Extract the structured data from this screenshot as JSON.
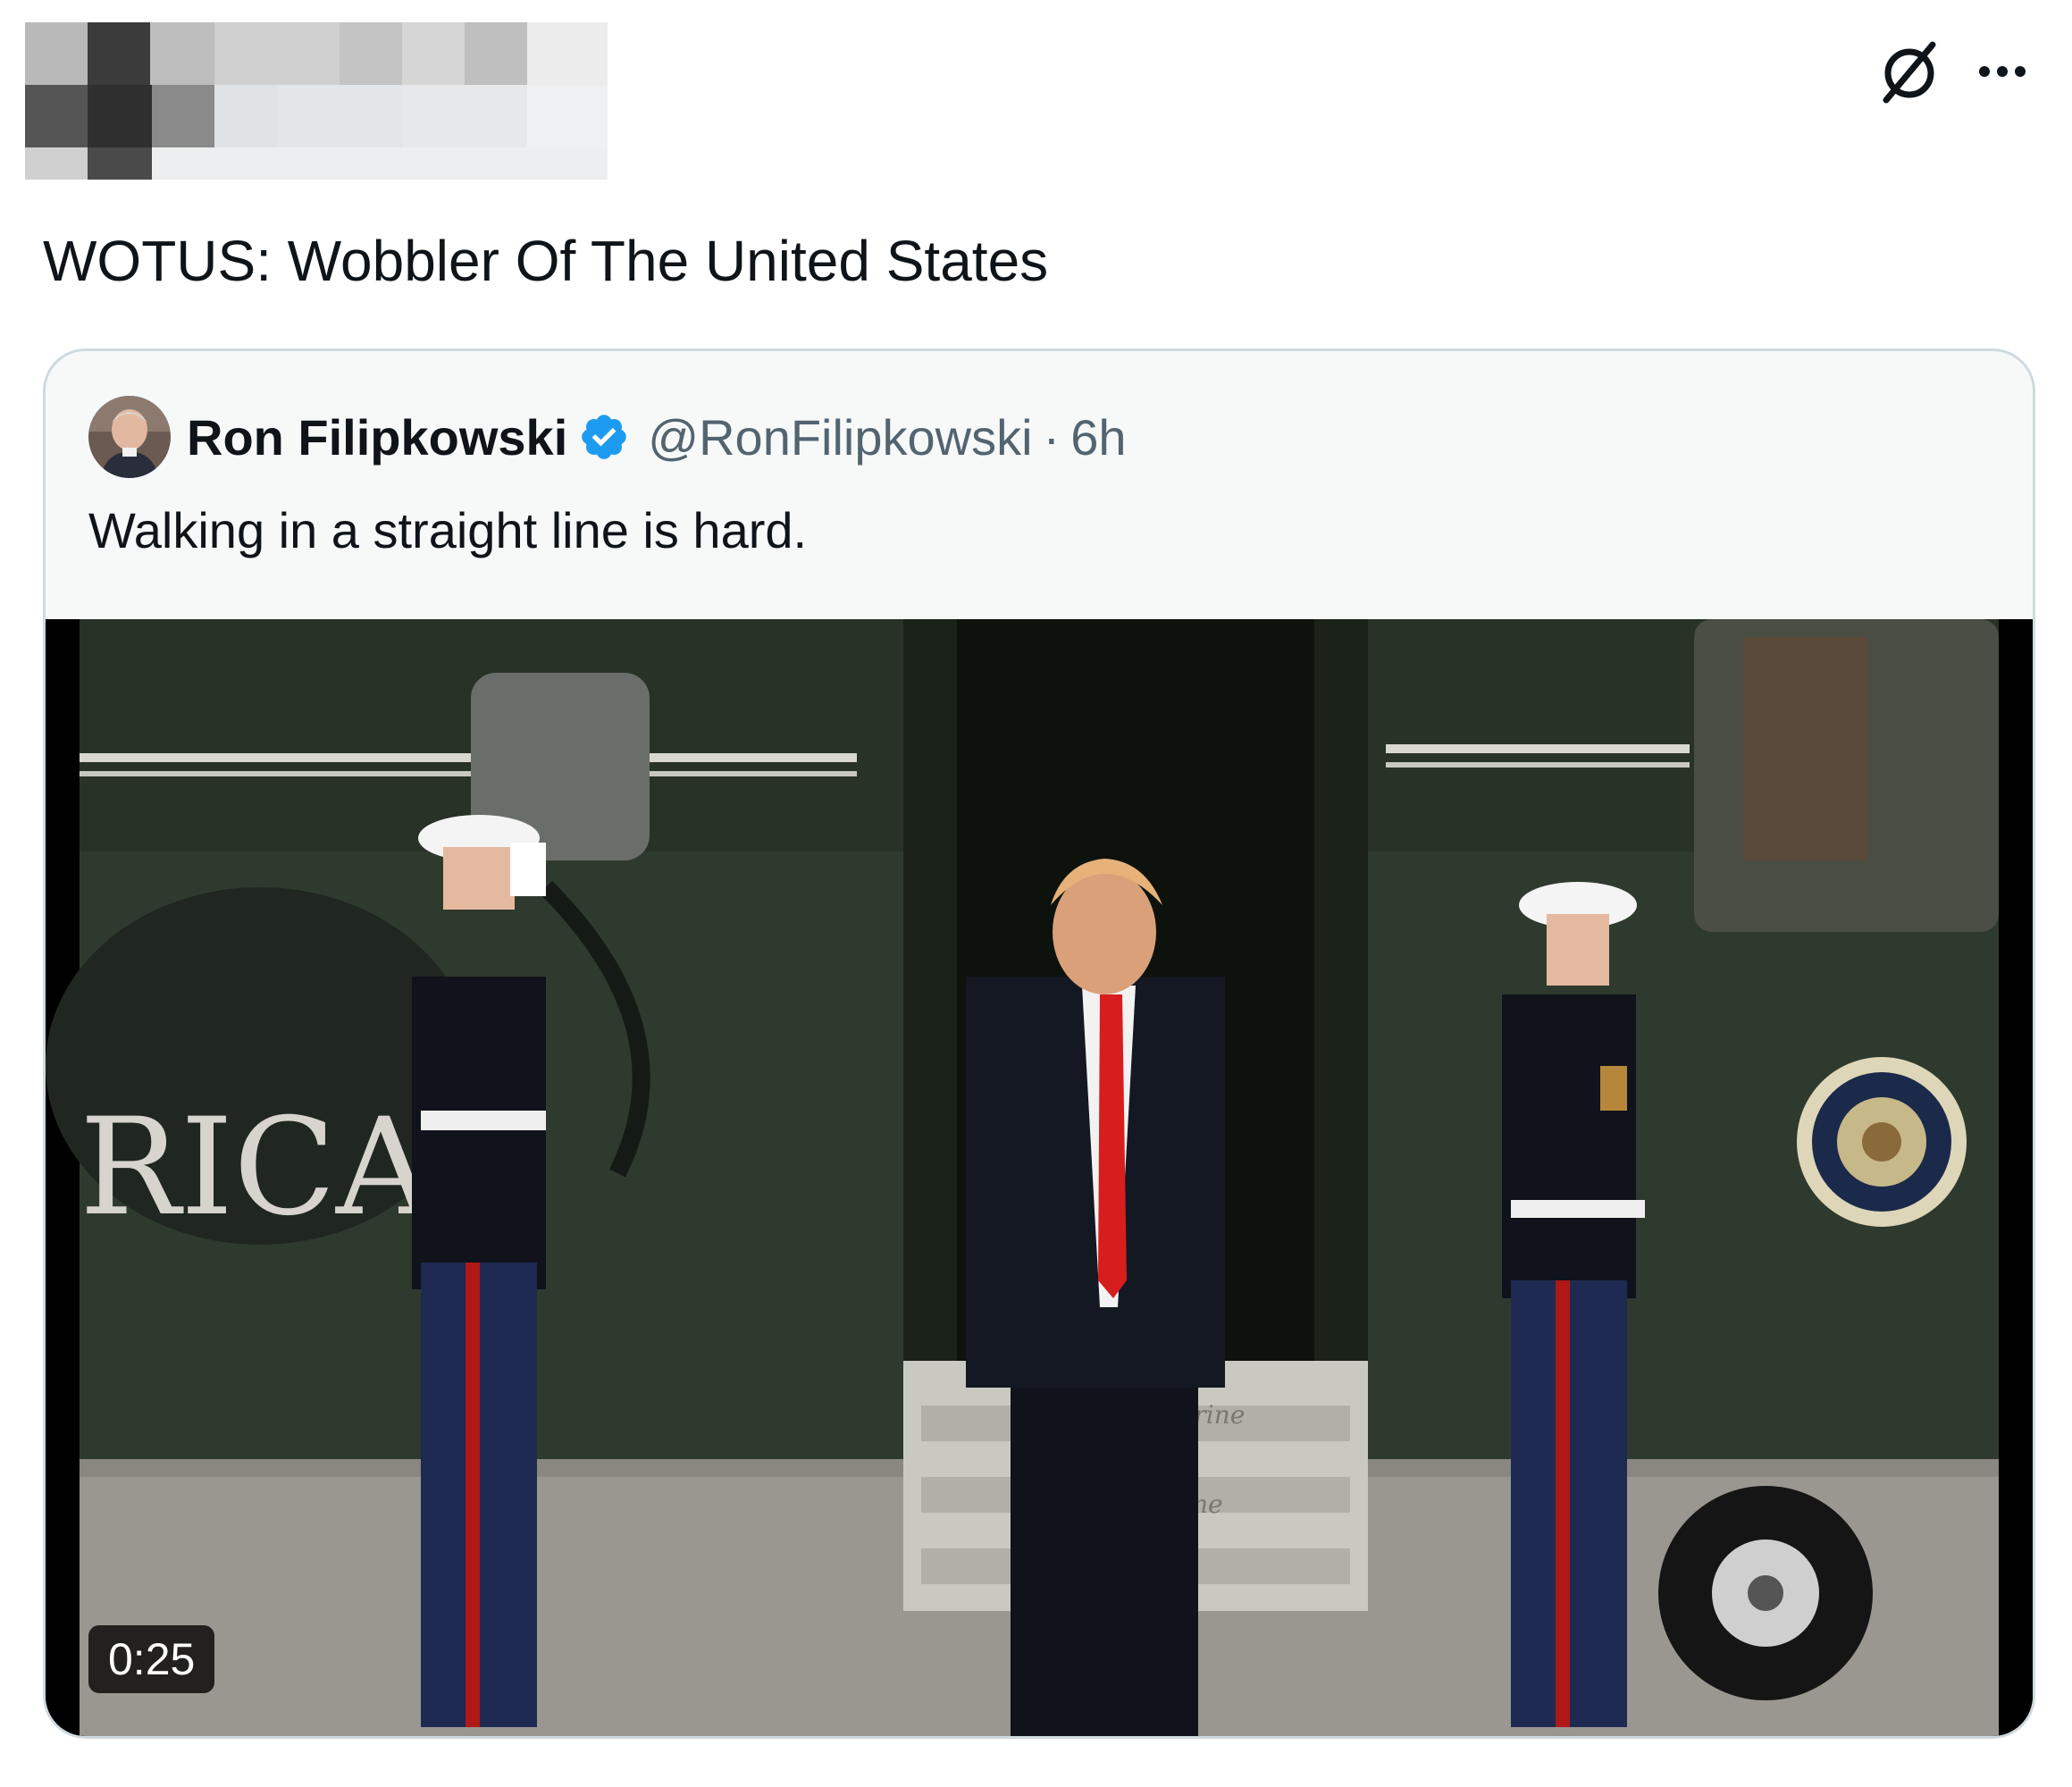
{
  "header": {
    "more_icon": "more-horizontal-icon",
    "grok_icon": "slash-circle-icon"
  },
  "tweet": {
    "text": "WOTUS: Wobbler Of The United States"
  },
  "quote": {
    "author_name": "Ron Filipkowski",
    "verified_icon": "verified-badge-icon",
    "handle": "@RonFilipkowski",
    "separator": "·",
    "time": "6h",
    "text": "Walking in a straight line is hard.",
    "video": {
      "duration": "0:25",
      "helicopter_lettering": "RICA",
      "step_lettering_top": "Marine",
      "step_lettering_bottom": "One"
    }
  },
  "colors": {
    "text_primary": "#0f1419",
    "text_secondary": "#536471",
    "verified_blue": "#1d9bf0",
    "card_border": "#cfd9de",
    "card_bg": "#f7f9f9"
  }
}
